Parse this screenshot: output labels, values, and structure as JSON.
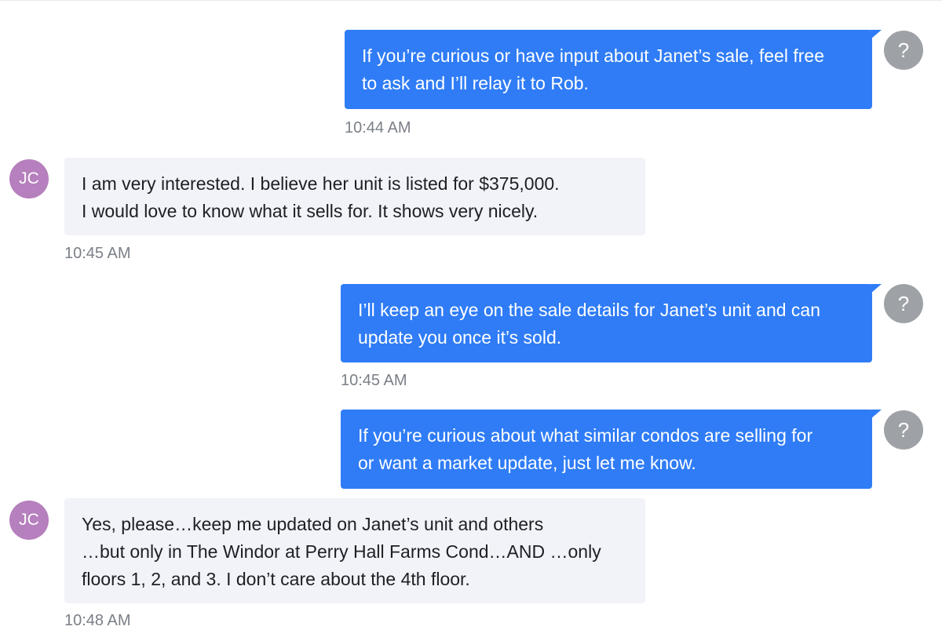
{
  "colors": {
    "outgoing": "#2f7cf6",
    "incoming": "#f2f3f8",
    "contact_avatar": "#b67fbd",
    "agent_avatar": "#9ea2a7"
  },
  "agent_avatar": {
    "icon": "question-mark-icon",
    "glyph": "?"
  },
  "contact_avatar": {
    "initials": "JC"
  },
  "messages": [
    {
      "direction": "outgoing",
      "lines": [
        "If you’re curious or have input about Janet’s sale, feel free",
        "to ask and I’ll relay it to Rob."
      ],
      "time": "10:44 AM"
    },
    {
      "direction": "incoming",
      "lines": [
        "I am very interested. I believe her unit is listed for $375,000.",
        "I would love to know what it sells for. It shows very nicely."
      ],
      "time": "10:45 AM"
    },
    {
      "direction": "outgoing",
      "lines": [
        "I’ll keep an eye on the sale details for Janet’s unit and can",
        "update you once it’s sold."
      ],
      "time": "10:45 AM"
    },
    {
      "direction": "outgoing",
      "lines": [
        "If you’re curious about what similar condos are selling for",
        "or want a market update, just let me know."
      ],
      "time": ""
    },
    {
      "direction": "incoming",
      "lines": [
        "Yes, please…keep me updated on Janet’s unit and others",
        "…but only in The Windor at Perry Hall Farms Cond…AND …only",
        "floors 1, 2, and 3. I don’t care about the 4th floor."
      ],
      "time": "10:48 AM"
    }
  ]
}
